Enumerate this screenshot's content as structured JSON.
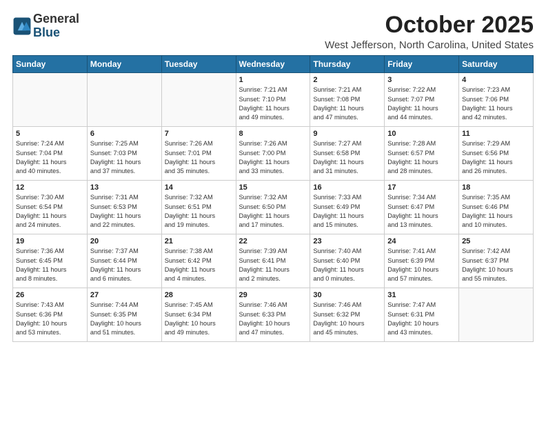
{
  "header": {
    "logo_line1": "General",
    "logo_line2": "Blue",
    "title": "October 2025",
    "subtitle": "West Jefferson, North Carolina, United States"
  },
  "days_of_week": [
    "Sunday",
    "Monday",
    "Tuesday",
    "Wednesday",
    "Thursday",
    "Friday",
    "Saturday"
  ],
  "weeks": [
    [
      {
        "num": "",
        "info": ""
      },
      {
        "num": "",
        "info": ""
      },
      {
        "num": "",
        "info": ""
      },
      {
        "num": "1",
        "info": "Sunrise: 7:21 AM\nSunset: 7:10 PM\nDaylight: 11 hours\nand 49 minutes."
      },
      {
        "num": "2",
        "info": "Sunrise: 7:21 AM\nSunset: 7:08 PM\nDaylight: 11 hours\nand 47 minutes."
      },
      {
        "num": "3",
        "info": "Sunrise: 7:22 AM\nSunset: 7:07 PM\nDaylight: 11 hours\nand 44 minutes."
      },
      {
        "num": "4",
        "info": "Sunrise: 7:23 AM\nSunset: 7:06 PM\nDaylight: 11 hours\nand 42 minutes."
      }
    ],
    [
      {
        "num": "5",
        "info": "Sunrise: 7:24 AM\nSunset: 7:04 PM\nDaylight: 11 hours\nand 40 minutes."
      },
      {
        "num": "6",
        "info": "Sunrise: 7:25 AM\nSunset: 7:03 PM\nDaylight: 11 hours\nand 37 minutes."
      },
      {
        "num": "7",
        "info": "Sunrise: 7:26 AM\nSunset: 7:01 PM\nDaylight: 11 hours\nand 35 minutes."
      },
      {
        "num": "8",
        "info": "Sunrise: 7:26 AM\nSunset: 7:00 PM\nDaylight: 11 hours\nand 33 minutes."
      },
      {
        "num": "9",
        "info": "Sunrise: 7:27 AM\nSunset: 6:58 PM\nDaylight: 11 hours\nand 31 minutes."
      },
      {
        "num": "10",
        "info": "Sunrise: 7:28 AM\nSunset: 6:57 PM\nDaylight: 11 hours\nand 28 minutes."
      },
      {
        "num": "11",
        "info": "Sunrise: 7:29 AM\nSunset: 6:56 PM\nDaylight: 11 hours\nand 26 minutes."
      }
    ],
    [
      {
        "num": "12",
        "info": "Sunrise: 7:30 AM\nSunset: 6:54 PM\nDaylight: 11 hours\nand 24 minutes."
      },
      {
        "num": "13",
        "info": "Sunrise: 7:31 AM\nSunset: 6:53 PM\nDaylight: 11 hours\nand 22 minutes."
      },
      {
        "num": "14",
        "info": "Sunrise: 7:32 AM\nSunset: 6:51 PM\nDaylight: 11 hours\nand 19 minutes."
      },
      {
        "num": "15",
        "info": "Sunrise: 7:32 AM\nSunset: 6:50 PM\nDaylight: 11 hours\nand 17 minutes."
      },
      {
        "num": "16",
        "info": "Sunrise: 7:33 AM\nSunset: 6:49 PM\nDaylight: 11 hours\nand 15 minutes."
      },
      {
        "num": "17",
        "info": "Sunrise: 7:34 AM\nSunset: 6:47 PM\nDaylight: 11 hours\nand 13 minutes."
      },
      {
        "num": "18",
        "info": "Sunrise: 7:35 AM\nSunset: 6:46 PM\nDaylight: 11 hours\nand 10 minutes."
      }
    ],
    [
      {
        "num": "19",
        "info": "Sunrise: 7:36 AM\nSunset: 6:45 PM\nDaylight: 11 hours\nand 8 minutes."
      },
      {
        "num": "20",
        "info": "Sunrise: 7:37 AM\nSunset: 6:44 PM\nDaylight: 11 hours\nand 6 minutes."
      },
      {
        "num": "21",
        "info": "Sunrise: 7:38 AM\nSunset: 6:42 PM\nDaylight: 11 hours\nand 4 minutes."
      },
      {
        "num": "22",
        "info": "Sunrise: 7:39 AM\nSunset: 6:41 PM\nDaylight: 11 hours\nand 2 minutes."
      },
      {
        "num": "23",
        "info": "Sunrise: 7:40 AM\nSunset: 6:40 PM\nDaylight: 11 hours\nand 0 minutes."
      },
      {
        "num": "24",
        "info": "Sunrise: 7:41 AM\nSunset: 6:39 PM\nDaylight: 10 hours\nand 57 minutes."
      },
      {
        "num": "25",
        "info": "Sunrise: 7:42 AM\nSunset: 6:37 PM\nDaylight: 10 hours\nand 55 minutes."
      }
    ],
    [
      {
        "num": "26",
        "info": "Sunrise: 7:43 AM\nSunset: 6:36 PM\nDaylight: 10 hours\nand 53 minutes."
      },
      {
        "num": "27",
        "info": "Sunrise: 7:44 AM\nSunset: 6:35 PM\nDaylight: 10 hours\nand 51 minutes."
      },
      {
        "num": "28",
        "info": "Sunrise: 7:45 AM\nSunset: 6:34 PM\nDaylight: 10 hours\nand 49 minutes."
      },
      {
        "num": "29",
        "info": "Sunrise: 7:46 AM\nSunset: 6:33 PM\nDaylight: 10 hours\nand 47 minutes."
      },
      {
        "num": "30",
        "info": "Sunrise: 7:46 AM\nSunset: 6:32 PM\nDaylight: 10 hours\nand 45 minutes."
      },
      {
        "num": "31",
        "info": "Sunrise: 7:47 AM\nSunset: 6:31 PM\nDaylight: 10 hours\nand 43 minutes."
      },
      {
        "num": "",
        "info": ""
      }
    ]
  ]
}
